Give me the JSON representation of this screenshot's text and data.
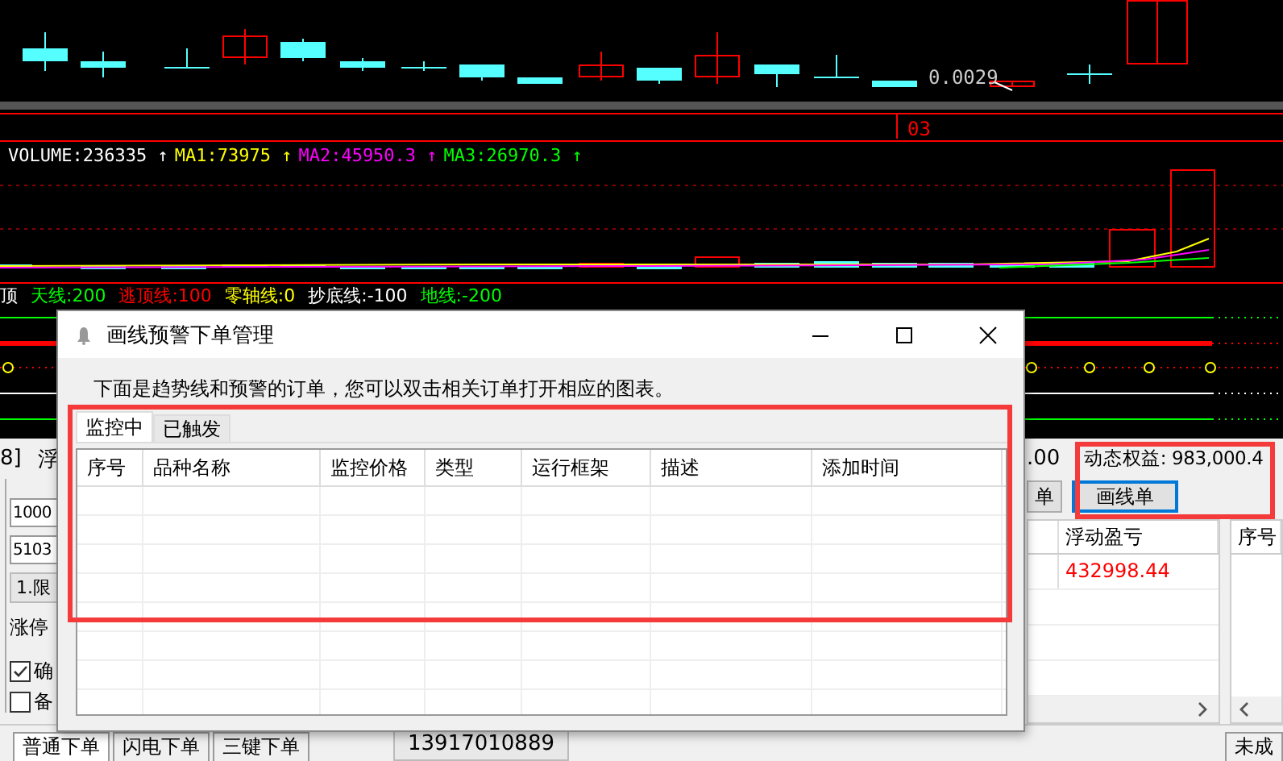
{
  "chart": {
    "price_label": "0.0029",
    "date_label": "03",
    "volume_legend": [
      {
        "text": "VOLUME:236335 ↑",
        "color": "#ffffff"
      },
      {
        "text": "MA1:73975 ↑",
        "color": "#ffff00"
      },
      {
        "text": "MA2:45950.3 ↑",
        "color": "#ff00ff"
      },
      {
        "text": "MA3:26970.3 ↑",
        "color": "#00ff00"
      }
    ],
    "indicator_legend": [
      {
        "text": "顶",
        "color": "#ffffff"
      },
      {
        "text": "天线:200",
        "color": "#00ff00"
      },
      {
        "text": "逃顶线:100",
        "color": "#ff0000"
      },
      {
        "text": "零轴线:0",
        "color": "#ffff00"
      },
      {
        "text": "抄底线:-100",
        "color": "#ffffff"
      },
      {
        "text": "地线:-200",
        "color": "#00ff00"
      }
    ]
  },
  "trade_panel": {
    "account_texts": [
      "8]",
      "浮"
    ],
    "balance_tail": ".00",
    "equity": "动态权益: 983,000.4",
    "order_fields": [
      "1000",
      "5103"
    ],
    "order_type": "1.限",
    "limit_label": "涨停",
    "options": [
      {
        "label": "确",
        "checked": true
      },
      {
        "label": "备",
        "checked": false
      }
    ],
    "order_tabs": [
      {
        "label": "单",
        "selected": false
      },
      {
        "label": "画线单",
        "selected": true
      }
    ],
    "positions": {
      "columns": [
        "浮动盈亏"
      ],
      "rows": [
        [
          "432998.44"
        ]
      ]
    },
    "orders": {
      "columns": [
        "序号"
      ]
    },
    "bottom_tabs": [
      {
        "label": "普通下单",
        "selected": true
      },
      {
        "label": "闪电下单",
        "selected": false
      },
      {
        "label": "三键下单",
        "selected": false
      }
    ],
    "account_id": "13917010889",
    "right_tab": "未成"
  },
  "dialog": {
    "title": "画线预警下单管理",
    "description": "下面是趋势线和预警的订单，您可以双击相关订单打开相应的图表。",
    "tabs": [
      {
        "label": "监控中",
        "selected": true
      },
      {
        "label": "已触发",
        "selected": false
      }
    ],
    "columns": [
      "序号",
      "品种名称",
      "监控价格",
      "类型",
      "运行框架",
      "描述",
      "添加时间"
    ]
  }
}
